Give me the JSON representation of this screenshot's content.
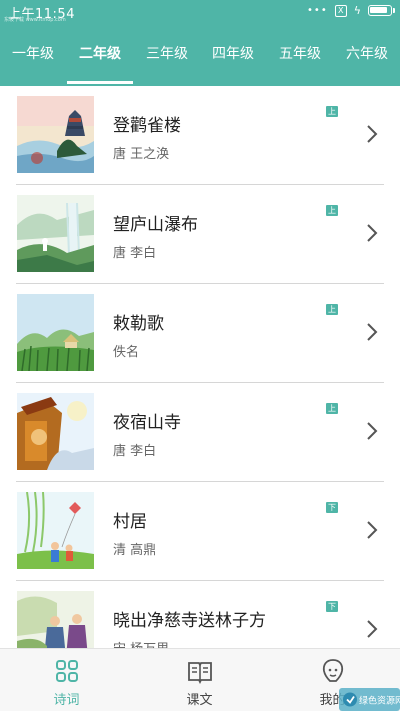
{
  "status_bar": {
    "time": "上午11:54",
    "watermark": "东坡下载 www.itmop.com",
    "sim_label": "X",
    "battery_level": 0.9
  },
  "colors": {
    "accent": "#4fb5a7",
    "header_bg": "#4fb5a7",
    "divider": "#d6d6d6"
  },
  "grade_tabs": [
    {
      "label": "一年级",
      "active": false
    },
    {
      "label": "二年级",
      "active": true
    },
    {
      "label": "三年级",
      "active": false
    },
    {
      "label": "四年级",
      "active": false
    },
    {
      "label": "五年级",
      "active": false
    },
    {
      "label": "六年级",
      "active": false
    }
  ],
  "poems": [
    {
      "title": "登鹳雀楼",
      "author": "唐 王之涣",
      "volume": "上",
      "icon": "chevron-right-icon"
    },
    {
      "title": "望庐山瀑布",
      "author": "唐 李白",
      "volume": "上",
      "icon": "chevron-right-icon"
    },
    {
      "title": "敕勒歌",
      "author": "佚名",
      "volume": "上",
      "icon": "chevron-right-icon"
    },
    {
      "title": "夜宿山寺",
      "author": "唐 李白",
      "volume": "上",
      "icon": "chevron-right-icon"
    },
    {
      "title": "村居",
      "author": "清 高鼎",
      "volume": "下",
      "icon": "chevron-right-icon"
    },
    {
      "title": "晓出净慈寺送林子方",
      "author": "宋 杨万里",
      "volume": "下",
      "icon": "chevron-right-icon"
    }
  ],
  "bottom_nav": [
    {
      "label": "诗词",
      "icon": "grid-icon",
      "active": true
    },
    {
      "label": "课文",
      "icon": "book-icon",
      "active": false
    },
    {
      "label": "我的",
      "icon": "person-icon",
      "active": false
    }
  ],
  "corner_badge": {
    "text": "绿色资源网"
  }
}
